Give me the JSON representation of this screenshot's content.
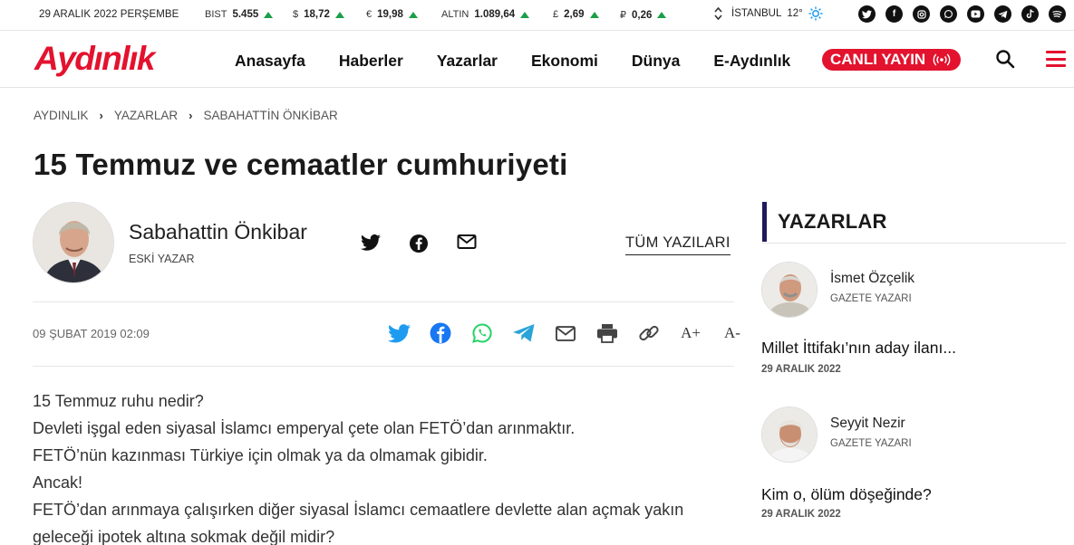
{
  "topbar": {
    "date": "29 ARALIK 2022 PERŞEMBE",
    "markets": [
      {
        "label": "BIST",
        "value": "5.455"
      },
      {
        "label": "$",
        "value": "18,72"
      },
      {
        "label": "€",
        "value": "19,98"
      },
      {
        "label": "ALTIN",
        "value": "1.089,64"
      },
      {
        "label": "£",
        "value": "2,69"
      },
      {
        "label": "₽",
        "value": "0,26"
      }
    ],
    "weather": {
      "city": "İSTANBUL",
      "temp": "12°"
    },
    "socials": [
      "twitter",
      "facebook",
      "instagram",
      "whatsapp",
      "youtube",
      "telegram",
      "tiktok",
      "spotify"
    ]
  },
  "header": {
    "logo": "Aydınlık",
    "nav": [
      "Anasayfa",
      "Haberler",
      "Yazarlar",
      "Ekonomi",
      "Dünya",
      "E-Aydınlık"
    ],
    "live_label": "CANLI YAYIN"
  },
  "breadcrumb": [
    "AYDINLIK",
    "YAZARLAR",
    "SABAHATTİN ÖNKİBAR"
  ],
  "article": {
    "title": "15 Temmuz ve cemaatler cumhuriyeti",
    "author": "Sabahattin Önkibar",
    "author_role": "ESKİ YAZAR",
    "all_posts": "TÜM YAZILARI",
    "date": "09 ŞUBAT 2019 02:09",
    "font_up": "A+",
    "font_down": "A-",
    "paragraphs": [
      "15 Temmuz ruhu nedir?",
      "Devleti işgal eden siyasal İslamcı emperyal çete olan FETÖ’dan arınmaktır.",
      "FETÖ’nün kazınması Türkiye için olmak ya da olmamak gibidir.",
      "Ancak!",
      "FETÖ’dan arınmaya çalışırken diğer siyasal İslamcı cemaatlere devlette alan açmak yakın geleceği ipotek altına sokmak değil midir?"
    ]
  },
  "sidebar": {
    "heading": "YAZARLAR",
    "writers": [
      {
        "name": "İsmet Özçelik",
        "role": "GAZETE YAZARI",
        "article": "Millet İttifakı’nın aday ilanı...",
        "date": "29 ARALIK 2022"
      },
      {
        "name": "Seyyit Nezir",
        "role": "GAZETE YAZARI",
        "article": "Kim o, ölüm döşeğinde?",
        "date": "29 ARALIK 2022"
      }
    ]
  },
  "colors": {
    "brand": "#e3122e",
    "up": "#1d9e4a",
    "sidebar_accent": "#1f1a5e",
    "twitter": "#1d9bf0",
    "facebook": "#1877f2",
    "whatsapp": "#25d366",
    "telegram": "#2aa3d8"
  }
}
